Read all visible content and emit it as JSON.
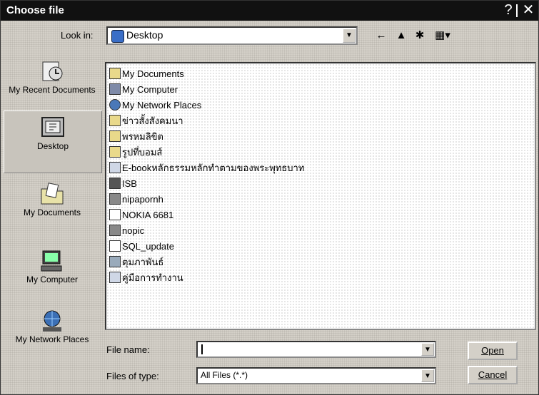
{
  "window": {
    "title": "Choose file",
    "help_glyph": "?",
    "close_glyph": "✕"
  },
  "lookin": {
    "label": "Look in:",
    "value": "Desktop"
  },
  "toolbar": {
    "back": "←",
    "up": "▲",
    "new_folder": "✱",
    "views": "▦▾"
  },
  "places": [
    {
      "label": "My Recent Documents"
    },
    {
      "label": "Desktop"
    },
    {
      "label": "My Documents"
    },
    {
      "label": "My Computer"
    },
    {
      "label": "My Network Places"
    }
  ],
  "files": [
    {
      "name": "My Documents"
    },
    {
      "name": "My Computer"
    },
    {
      "name": "My Network Places"
    },
    {
      "name": "ข่าวสั้งสังคมนา"
    },
    {
      "name": "พรหมลิขิต"
    },
    {
      "name": "รูปที่บอมส์"
    },
    {
      "name": "E-bookหลักธรรมหลักทำตามของพระพุทธบาท"
    },
    {
      "name": "ISB"
    },
    {
      "name": "nipapornh"
    },
    {
      "name": "NOKIA 6681"
    },
    {
      "name": "nopic"
    },
    {
      "name": "SQL_update"
    },
    {
      "name": "ตุมภาพันธ์"
    },
    {
      "name": "คู่มือการทำงาน"
    }
  ],
  "filename": {
    "label": "File name:",
    "value": ""
  },
  "filetype": {
    "label": "Files of type:",
    "value": "All Files (*.*)"
  },
  "buttons": {
    "open": "Open",
    "cancel": "Cancel"
  }
}
